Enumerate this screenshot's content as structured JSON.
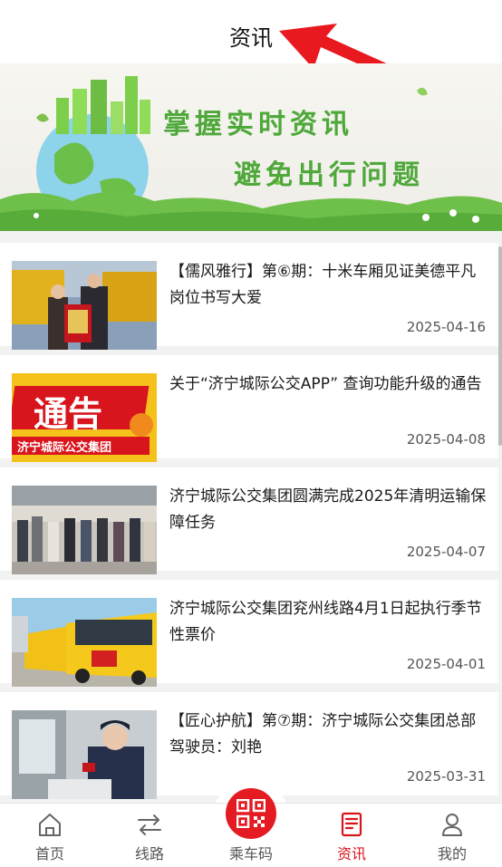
{
  "header": {
    "title": "资讯"
  },
  "banner": {
    "line1": "掌握实时资讯",
    "line2": "避免出行问题"
  },
  "news": [
    {
      "title": "【儒风雅行】第⑥期：十米车厢见证美德平凡岗位书写大爱",
      "date": "2025-04-16",
      "thumb": "award-photo"
    },
    {
      "title": "关于“济宁城际公交APP” 查询功能升级的通告",
      "date": "2025-04-08",
      "thumb": "notice-image",
      "thumb_big_text": "通告",
      "thumb_small_text": "济宁城际公交集团"
    },
    {
      "title": "济宁城际公交集团圆满完成2025年清明运输保障任务",
      "date": "2025-04-07",
      "thumb": "station-crowd-photo"
    },
    {
      "title": "济宁城际公交集团兖州线路4月1日起执行季节性票价",
      "date": "2025-04-01",
      "thumb": "buses-photo"
    },
    {
      "title": "【匠心护航】第⑦期：济宁城际公交集团总部驾驶员：刘艳",
      "date": "2025-03-31",
      "thumb": "driver-photo"
    }
  ],
  "tabs": [
    {
      "label": "首页",
      "icon": "home-icon",
      "active": false
    },
    {
      "label": "线路",
      "icon": "route-icon",
      "active": false
    },
    {
      "label": "乘车码",
      "icon": "qr-code-icon",
      "active": false
    },
    {
      "label": "资讯",
      "icon": "news-icon",
      "active": true
    },
    {
      "label": "我的",
      "icon": "user-icon",
      "active": false
    }
  ],
  "colors": {
    "accent": "#d8141c",
    "qr_button": "#e51b23",
    "banner_text": "#4ea83a"
  }
}
